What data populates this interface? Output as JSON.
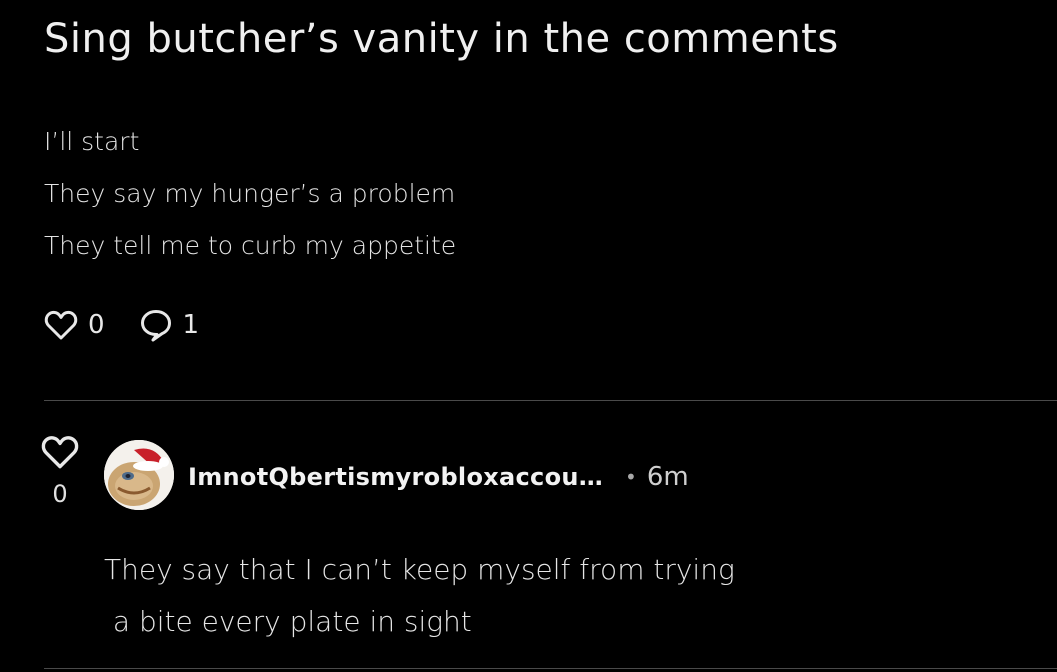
{
  "post": {
    "title": "Sing butcher’s vanity in the comments",
    "body_lines": [
      "I’ll start",
      "They say my hunger’s a problem",
      "They tell me to curb my appetite"
    ],
    "like_count": "0",
    "comment_count": "1"
  },
  "comment": {
    "vote_count": "0",
    "username": "ImnotQbertismyrobloxaccou…",
    "separator": "•",
    "timestamp": "6m",
    "body_lines": [
      "They say that I can’t keep myself from trying",
      " a bite every plate in sight"
    ],
    "avatar_icon": "santa-hat-avatar-icon"
  },
  "colors": {
    "background": "#000000",
    "text": "#e8e8e8",
    "divider": "#4a4a4a"
  }
}
